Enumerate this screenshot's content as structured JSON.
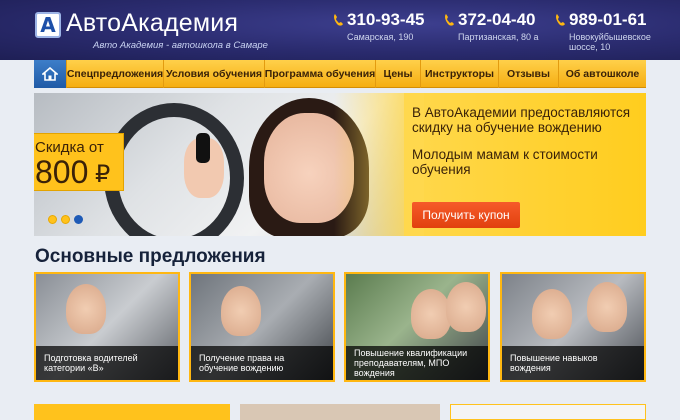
{
  "header": {
    "logo_letter": "А",
    "site_name": "АвтоАкадемия",
    "tagline": "Авто Академия - автошкола в Самаре",
    "phones": [
      {
        "number": "310-93-45",
        "address": "Самарская, 190"
      },
      {
        "number": "372-04-40",
        "address": "Партизанская, 80 а"
      },
      {
        "number": "989-01-61",
        "address_line1": "Новокуйбышевское",
        "address_line2": "шоссе, 10"
      }
    ]
  },
  "nav": {
    "items": [
      "Спецпредложения",
      "Условия обучения",
      "Программа обучения",
      "Цены",
      "Инструкторы",
      "Отзывы",
      "Об автошколе"
    ]
  },
  "banner": {
    "discount_line1": "Скидка от",
    "discount_amount": "800",
    "discount_currency": "₽",
    "text1": "В АвтоАкадемии предоставляются скидку на обучение вождению",
    "text2": "Молодым мамам к стоимости обучения",
    "button_label": "Получить купон"
  },
  "offers": {
    "title": "Основные предложения",
    "cards": [
      {
        "caption": "Подготовка водителей категории «В»"
      },
      {
        "caption": "Получение права на обучение вождению"
      },
      {
        "caption": "Повышение квалификации преподавателям, МПО вождения"
      },
      {
        "caption": "Повышение навыков вождения"
      }
    ]
  },
  "colors": {
    "header_bg": "#2a2b6e",
    "nav_bg": "#ffc21c",
    "accent_orange": "#e1400e",
    "card_border": "#ffb711",
    "slider_active": "#1e5ab6"
  }
}
